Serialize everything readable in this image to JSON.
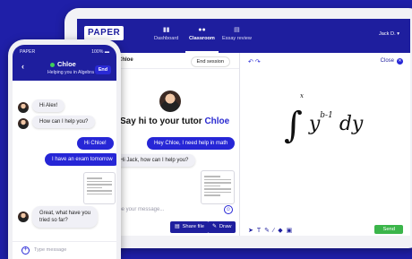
{
  "tablet": {
    "logo": "PAPER",
    "nav": {
      "tabs": [
        {
          "label": "Dashboard",
          "icon": "chart-icon"
        },
        {
          "label": "Classroom",
          "icon": "people-icon"
        },
        {
          "label": "Essay review",
          "icon": "document-icon"
        }
      ],
      "active_tab": "Classroom",
      "user": "Jack D."
    },
    "chat": {
      "title": "Chloe",
      "end_session": "End session",
      "hero_prefix": "Say hi to your tutor",
      "hero_name": "Chloe",
      "messages": {
        "m1": "Hey Chloe, I need help in math",
        "m2": "Hi Jack, how can I help you?"
      },
      "input_placeholder": "Type your message...",
      "share_file": "Share file",
      "draw": "Draw"
    },
    "whiteboard": {
      "close": "Close",
      "send": "Send",
      "math": {
        "integral_upper": "x",
        "integral_lower": "1",
        "base": "y",
        "exponent": "b-1",
        "differential": "dy"
      }
    }
  },
  "phone": {
    "status_carrier": "PAPER",
    "status_battery": "100%",
    "contact": "Chloe",
    "subtitle": "Helping you in Algebra",
    "end": "End",
    "messages": {
      "m1": "Hi Alex!",
      "m2": "How can I help you?",
      "m3": "Hi Chloe!",
      "m4": "I have an exam tomorrow",
      "m5_line1": "Great, what have you",
      "m5_line2": "tried so far?"
    },
    "input_placeholder": "Type message"
  },
  "colors": {
    "brand": "#1e1e9e",
    "accent": "#2626d6",
    "send": "#3bb54a",
    "background": "#1f1fa8"
  }
}
